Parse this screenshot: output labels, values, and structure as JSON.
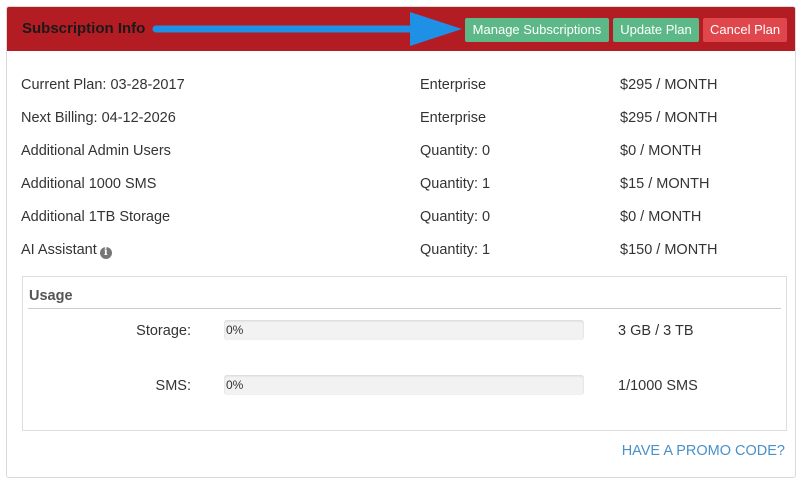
{
  "header": {
    "title": "Subscription Info",
    "buttons": {
      "manage": "Manage Subscriptions",
      "update": "Update Plan",
      "cancel": "Cancel Plan"
    },
    "colors": {
      "header_bg": "#b31c22",
      "green_button": "#5cb886",
      "red_button": "#e0474c",
      "arrow": "#1e90e6"
    }
  },
  "subscriptions": [
    {
      "name": "Current Plan: 03-28-2017",
      "detail": "Enterprise",
      "price": "$295 / MONTH"
    },
    {
      "name": "Next Billing: 04-12-2026",
      "detail": "Enterprise",
      "price": "$295 / MONTH"
    },
    {
      "name": "Additional Admin Users",
      "detail": "Quantity: 0",
      "price": "$0 / MONTH"
    },
    {
      "name": "Additional 1000 SMS",
      "detail": "Quantity: 1",
      "price": "$15 / MONTH"
    },
    {
      "name": "Additional 1TB Storage",
      "detail": "Quantity: 0",
      "price": "$0 / MONTH"
    },
    {
      "name": "AI Assistant",
      "detail": "Quantity: 1",
      "price": "$150 / MONTH",
      "icon": "info-icon"
    }
  ],
  "usage": {
    "title": "Usage",
    "items": [
      {
        "label": "Storage:",
        "percent": 0,
        "percent_text": "0%",
        "value": "3 GB / 3 TB"
      },
      {
        "label": "SMS:",
        "percent": 0,
        "percent_text": "0%",
        "value": "1/1000 SMS"
      }
    ]
  },
  "promo": {
    "link": "HAVE A PROMO CODE?"
  }
}
